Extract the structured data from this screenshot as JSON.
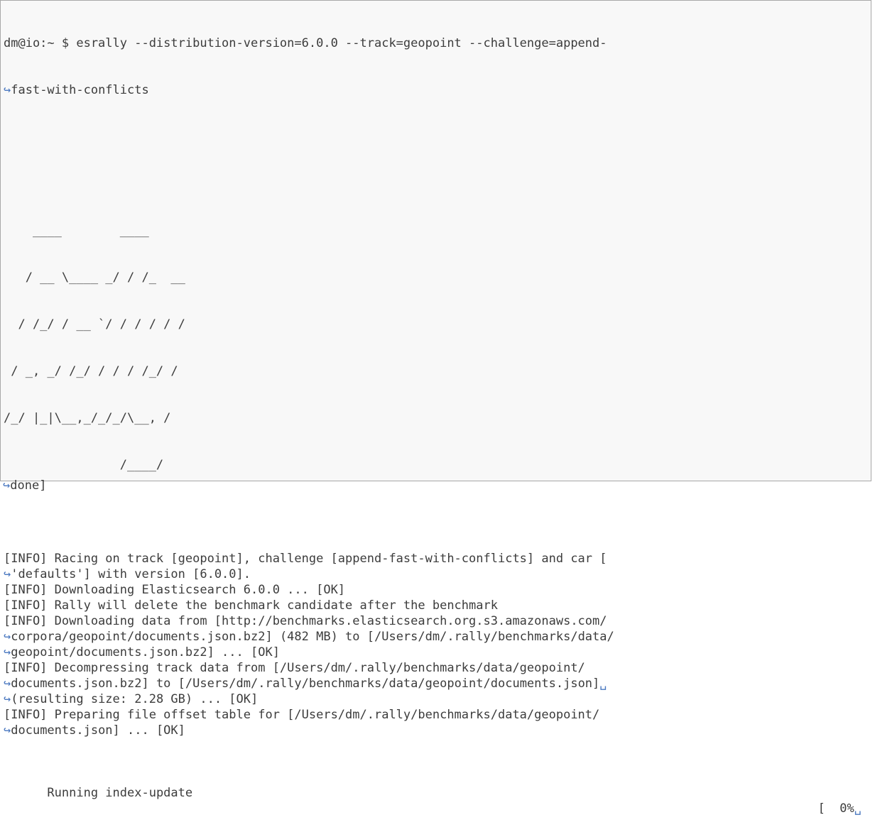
{
  "prompt": "dm@io:~ $ esrally --distribution-version=6.0.0 --track=geopoint --challenge=append-",
  "prompt_cont": "fast-with-conflicts",
  "wrap_glyph": "↪",
  "eol_glyph": "␣",
  "logo_lines": [
    "    ____        ____",
    "   / __ \\____ _/ / /_  __",
    "  / /_/ / __ `/ / / / / /",
    " / _, _/ /_/ / / / /_/ /",
    "/_/ |_|\\__,_/_/_/\\__, /",
    "                /____/"
  ],
  "log": [
    {
      "text": "[INFO] Racing on track [geopoint], challenge [append-fast-with-conflicts] and car [",
      "wrap": false
    },
    {
      "text": "'defaults'] with version [6.0.0].",
      "wrap": true
    },
    {
      "text": "[INFO] Downloading Elasticsearch 6.0.0 ... [OK]",
      "wrap": false
    },
    {
      "text": "[INFO] Rally will delete the benchmark candidate after the benchmark",
      "wrap": false
    },
    {
      "text": "[INFO] Downloading data from [http://benchmarks.elasticsearch.org.s3.amazonaws.com/",
      "wrap": false
    },
    {
      "text": "corpora/geopoint/documents.json.bz2] (482 MB) to [/Users/dm/.rally/benchmarks/data/",
      "wrap": true
    },
    {
      "text": "geopoint/documents.json.bz2] ... [OK]",
      "wrap": true
    },
    {
      "text": "[INFO] Decompressing track data from [/Users/dm/.rally/benchmarks/data/geopoint/",
      "wrap": false
    },
    {
      "text": "documents.json.bz2] to [/Users/dm/.rally/benchmarks/data/geopoint/documents.json]",
      "wrap": true,
      "eol": true
    },
    {
      "text": "(resulting size: 2.28 GB) ... [OK]",
      "wrap": true
    },
    {
      "text": "[INFO] Preparing file offset table for [/Users/dm/.rally/benchmarks/data/geopoint/",
      "wrap": false
    },
    {
      "text": "documents.json] ... [OK]",
      "wrap": true
    }
  ],
  "progress": {
    "label": "Running index-update",
    "bracket": "[  0%",
    "continuation": "done]"
  }
}
